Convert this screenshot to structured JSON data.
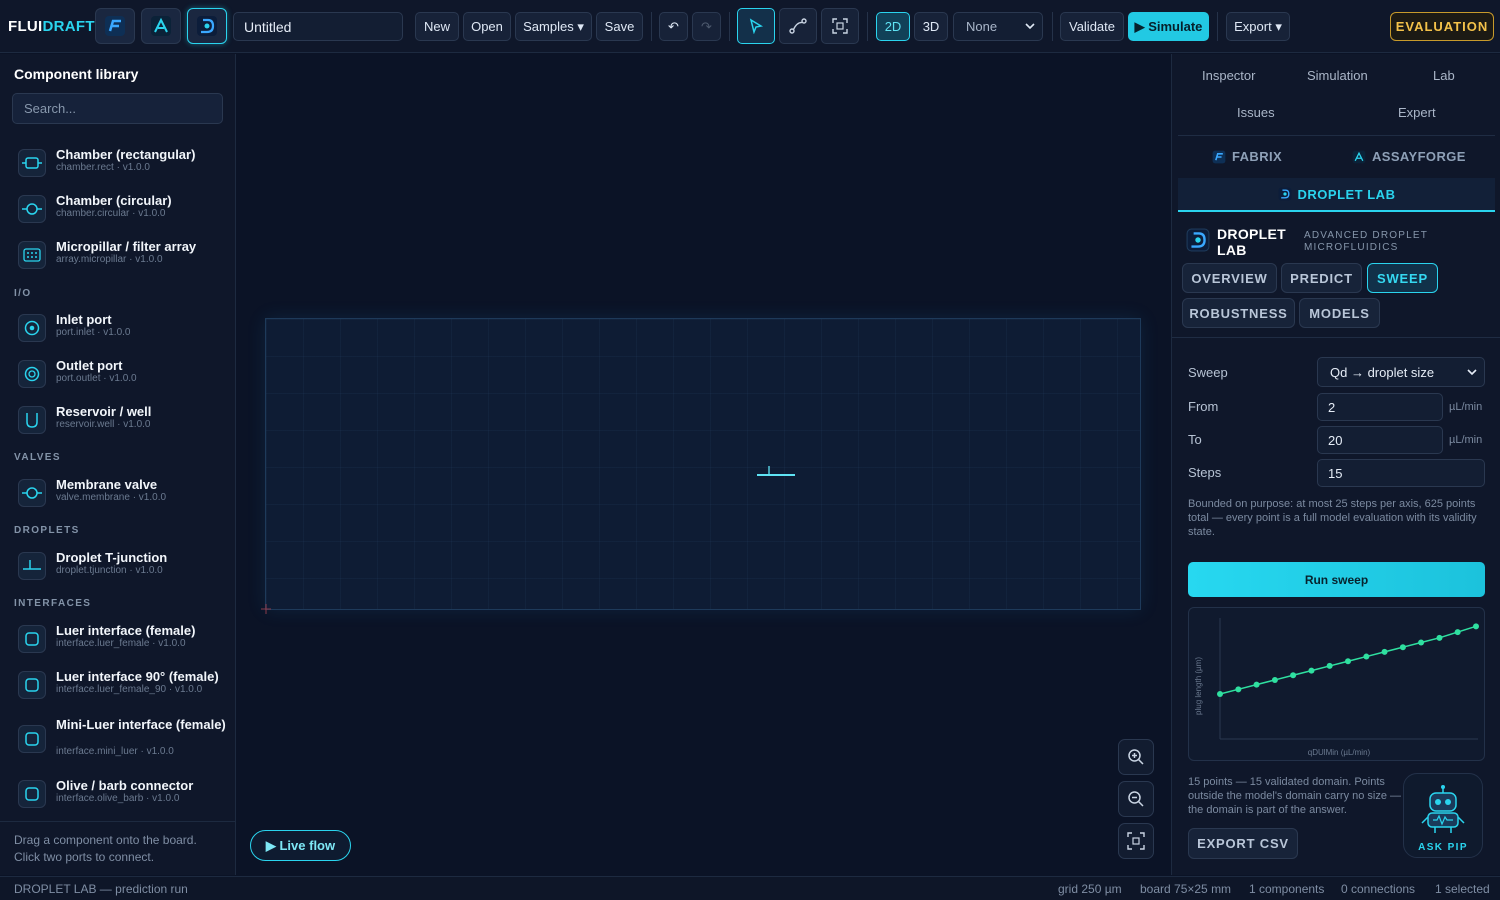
{
  "app": {
    "logo_part1": "FLUI",
    "logo_part2": "DRAFT",
    "doc_title": "Untitled"
  },
  "toolbar": {
    "new": "New",
    "open": "Open",
    "samples": "Samples ▾",
    "save": "Save",
    "undo": "↶",
    "redo": "↷",
    "mode_2d": "2D",
    "mode_3d": "3D",
    "view_select": "None",
    "validate": "Validate",
    "simulate": "▶ Simulate",
    "export": "Export ▾",
    "evaluation": "EVALUATION"
  },
  "library": {
    "title": "Component library",
    "search_placeholder": "Search...",
    "sections": {
      "io": "I/O",
      "valves": "VALVES",
      "droplets": "DROPLETS",
      "interfaces": "INTERFACES"
    },
    "items": [
      {
        "name": "Chamber (rectangular)",
        "sub": "chamber.rect · v1.0.0",
        "icon": "chamber-rect-icon"
      },
      {
        "name": "Chamber (circular)",
        "sub": "chamber.circular · v1.0.0",
        "icon": "chamber-circular-icon"
      },
      {
        "name": "Micropillar / filter array",
        "sub": "array.micropillar · v1.0.0",
        "icon": "micropillar-icon"
      },
      {
        "name": "Inlet port",
        "sub": "port.inlet · v1.0.0",
        "icon": "inlet-port-icon"
      },
      {
        "name": "Outlet port",
        "sub": "port.outlet · v1.0.0",
        "icon": "outlet-port-icon"
      },
      {
        "name": "Reservoir / well",
        "sub": "reservoir.well · v1.0.0",
        "icon": "reservoir-icon"
      },
      {
        "name": "Membrane valve",
        "sub": "valve.membrane · v1.0.0",
        "icon": "membrane-valve-icon"
      },
      {
        "name": "Droplet T-junction",
        "sub": "droplet.tjunction · v1.0.0",
        "icon": "t-junction-icon"
      },
      {
        "name": "Luer interface (female)",
        "sub": "interface.luer_female · v1.0.0",
        "icon": "interface-icon"
      },
      {
        "name": "Luer interface 90° (female)",
        "sub": "interface.luer_female_90 · v1.0.0",
        "icon": "interface-icon"
      },
      {
        "name": "Mini-Luer interface (female)",
        "sub": "interface.mini_luer · v1.0.0",
        "icon": "interface-icon"
      },
      {
        "name": "Olive / barb connector",
        "sub": "interface.olive_barb · v1.0.0",
        "icon": "interface-icon"
      }
    ],
    "hint": "Drag a component onto the board. Click two ports to connect."
  },
  "canvas": {
    "live_flow": "▶ Live flow"
  },
  "right_panel": {
    "tabs": [
      "Inspector",
      "Simulation",
      "Lab",
      "Issues",
      "Expert"
    ],
    "apps": [
      "FABRIX",
      "ASSAYFORGE",
      "DROPLET LAB"
    ],
    "droplet_lab": {
      "name": "DROPLET LAB",
      "subtitle": "ADVANCED DROPLET MICROFLUIDICS",
      "subtabs": [
        "OVERVIEW",
        "PREDICT",
        "SWEEP",
        "ROBUSTNESS",
        "MODELS"
      ],
      "active_subtab": "SWEEP"
    },
    "sweep": {
      "sweep_label": "Sweep",
      "sweep_value": "Qd → droplet size",
      "from_label": "From",
      "from_value": "2",
      "to_label": "To",
      "to_value": "20",
      "steps_label": "Steps",
      "steps_value": "15",
      "unit": "µL/min",
      "note": "Bounded on purpose: at most 25 steps per axis, 625 points total — every point is a full model evaluation with its validity state.",
      "run": "Run sweep",
      "result": "15 points — 15 validated domain. Points outside the model's domain carry no size — the domain is part of the answer.",
      "export_csv": "EXPORT CSV",
      "ask_pip": "ASK PIP"
    }
  },
  "chart_data": {
    "type": "line",
    "xlabel": "qDUlMin (µL/min)",
    "ylabel": "plug length (µm)",
    "x": [
      2,
      3.29,
      4.57,
      5.86,
      7.14,
      8.43,
      9.71,
      11,
      12.29,
      13.57,
      14.86,
      16.14,
      17.43,
      18.71,
      20
    ],
    "series": [
      {
        "values": [
          0.0,
          0.065,
          0.13,
          0.195,
          0.26,
          0.325,
          0.39,
          0.455,
          0.52,
          0.585,
          0.65,
          0.715,
          0.78,
          0.86,
          0.94
        ]
      }
    ],
    "color": "#2fe0a0",
    "grid": false,
    "ylim": [
      0,
      1
    ]
  },
  "status": {
    "left": "DROPLET LAB — prediction run",
    "grid": "grid 250 µm",
    "board": "board 75×25 mm",
    "components": "1 components",
    "connections": "0 connections",
    "selected": "1 selected"
  },
  "colors": {
    "accent": "#2ad4ee",
    "evaluation": "#f4c24a",
    "chart_line": "#2fe0a0"
  }
}
